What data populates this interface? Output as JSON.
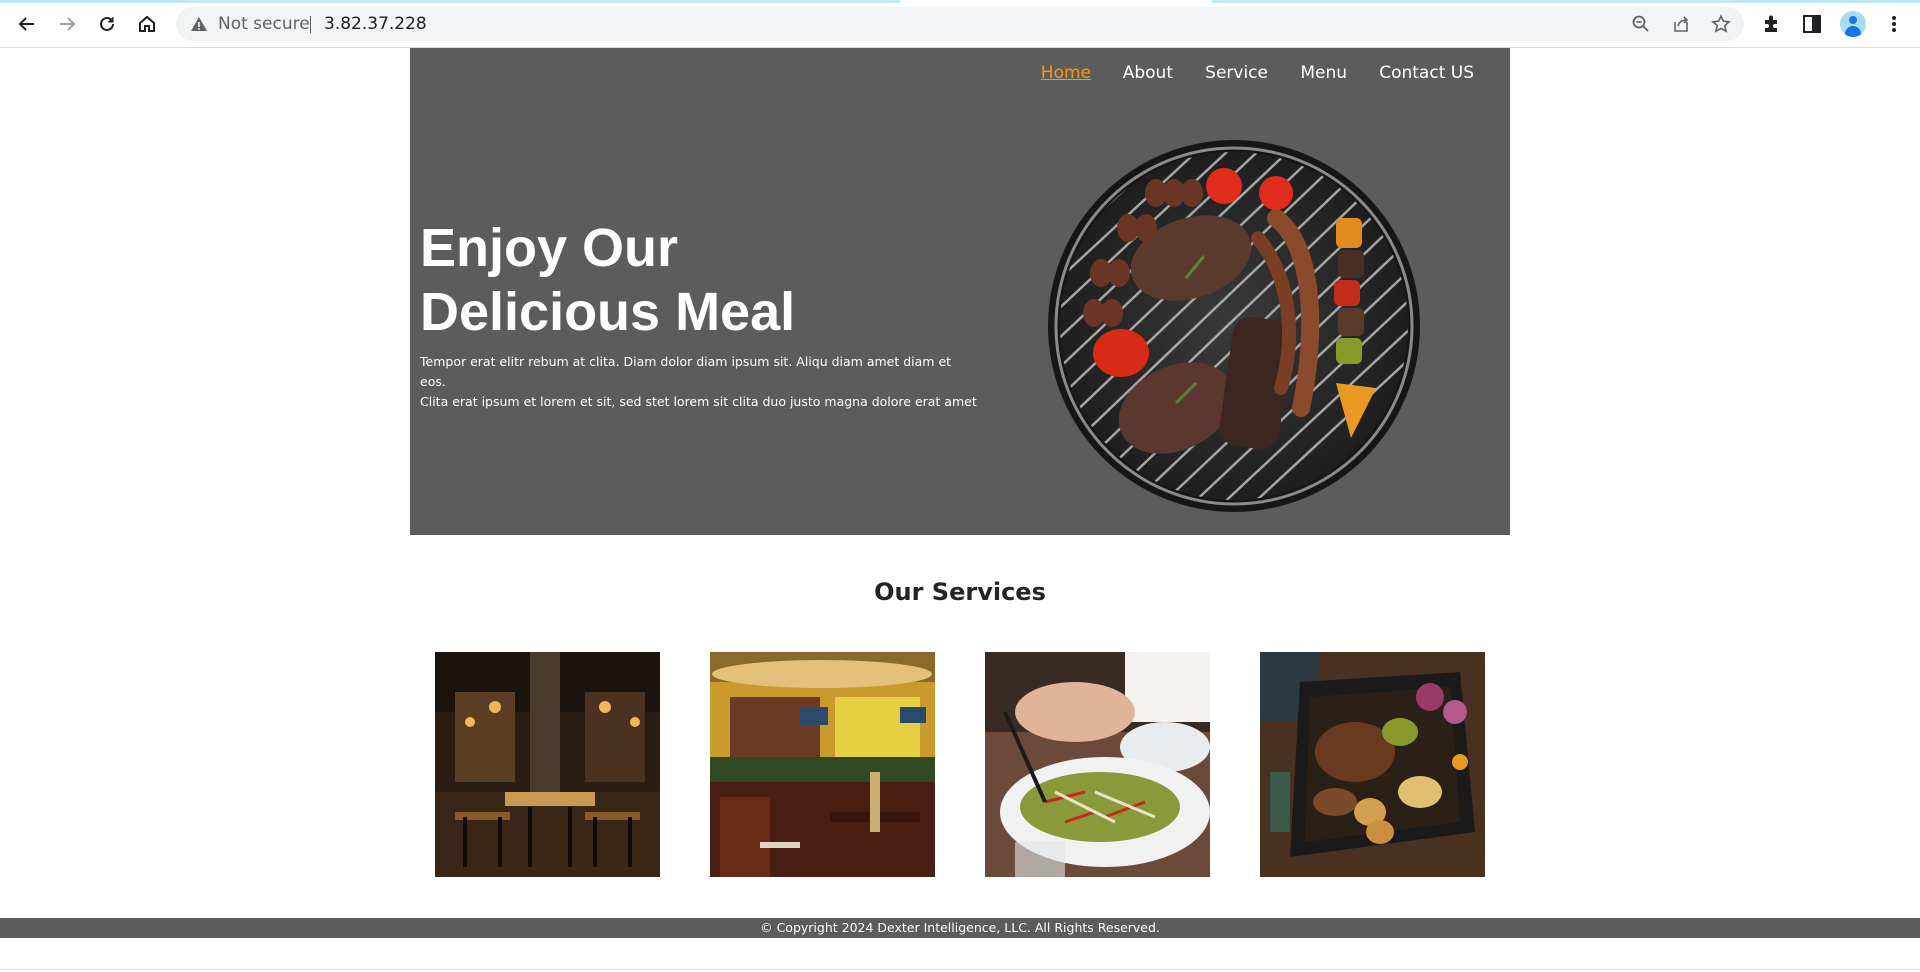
{
  "browser": {
    "security_label": "Not secure",
    "url": "3.82.37.228",
    "toolbar_icons": [
      "back-icon",
      "forward-icon",
      "reload-icon",
      "home-icon",
      "zoom-icon",
      "share-icon",
      "star-icon",
      "extensions-icon",
      "side-panel-icon",
      "profile-avatar",
      "menu-icon"
    ]
  },
  "nav": {
    "items": [
      {
        "label": "Home",
        "active": true
      },
      {
        "label": "About",
        "active": false
      },
      {
        "label": "Service",
        "active": false
      },
      {
        "label": "Menu",
        "active": false
      },
      {
        "label": "Contact US",
        "active": false
      }
    ]
  },
  "hero": {
    "title_line1": "Enjoy Our",
    "title_line2": "Delicious Meal",
    "text_line1": "Tempor erat elitr rebum at clita. Diam dolor diam ipsum sit. Aliqu diam amet diam et eos.",
    "text_line2": "Clita erat ipsum et lorem et sit, sed stet lorem sit clita duo justo magna dolore erat amet",
    "image": "grilled-meat-platter"
  },
  "services": {
    "title": "Our Services",
    "images": [
      "restaurant-interior-dark",
      "restaurant-bar-interior",
      "salad-dining",
      "food-platter-table"
    ]
  },
  "footer": {
    "text": "© Copyright 2024 Dexter Intelligence, LLC. All Rights Reserved."
  },
  "colors": {
    "hero_bg": "#5c5c5c",
    "nav_active": "#ff9800",
    "footer_bg": "#5c5c5c"
  }
}
